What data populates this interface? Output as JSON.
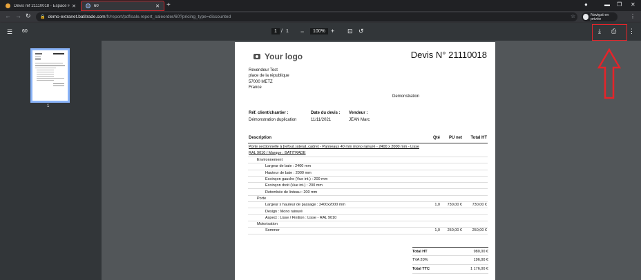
{
  "tabs": [
    {
      "title": "Devis réf 21110018 - Espace Pro"
    },
    {
      "title": "60"
    }
  ],
  "address_bar": {
    "url_host": "demo-extranet.batitrade.com",
    "url_path": "/fr/report/pdf/sale.report_saleorder/60?pricing_type=discounted"
  },
  "browser": {
    "incognito_label": "Navigat en privée"
  },
  "pdf_toolbar": {
    "doc_title": "60",
    "page_current": "1",
    "page_total": "1",
    "zoom": "100%"
  },
  "sidebar": {
    "thumb_label": "1"
  },
  "document": {
    "logo_text": "Your logo",
    "title": "Devis N° 21110018",
    "address": [
      "Revendeur Test",
      "place de la république",
      "57000 METZ",
      "France"
    ],
    "customer": "Demonstration",
    "meta": {
      "ref_label": "Réf. client/chantier :",
      "ref_value": "Démonstration duplication",
      "date_label": "Date du devis :",
      "date_value": "11/11/2021",
      "vendor_label": "Vendeur :",
      "vendor_value": "JEAN Marc"
    },
    "table_headers": {
      "description": "Description",
      "qty": "Qté",
      "unit": "PU net",
      "total": "Total HT"
    },
    "lines": [
      {
        "desc": "Porte sectionnelle à [refoul_lateral_cadre] - Panneaux 40 mm mono rainuré - 2400 x 2000 mm - Lisse RAL 9010 / Marque : BATITRADE",
        "indent": 0,
        "qty": "",
        "unit": "",
        "total": "",
        "style": "product"
      },
      {
        "desc": "Environnement",
        "indent": 1,
        "qty": "",
        "unit": "",
        "total": ""
      },
      {
        "desc": "Largeur de baie : 2400 mm",
        "indent": 2,
        "qty": "",
        "unit": "",
        "total": ""
      },
      {
        "desc": "Hauteur de baie : 2000 mm",
        "indent": 2,
        "qty": "",
        "unit": "",
        "total": ""
      },
      {
        "desc": "Ecoinçon gauche (Vue int.) : 200 mm",
        "indent": 2,
        "qty": "",
        "unit": "",
        "total": ""
      },
      {
        "desc": "Ecoinçon droit (Vue int.) : 200 mm",
        "indent": 2,
        "qty": "",
        "unit": "",
        "total": ""
      },
      {
        "desc": "Retombée de linteau : 200 mm",
        "indent": 2,
        "qty": "",
        "unit": "",
        "total": ""
      },
      {
        "desc": "Porte",
        "indent": 1,
        "qty": "",
        "unit": "",
        "total": ""
      },
      {
        "desc": "Largeur x hauteur de passage : 2400x2000 mm",
        "indent": 2,
        "qty": "1,0",
        "unit": "730,00 €",
        "total": "730,00 €"
      },
      {
        "desc": "Design : Mono rainuré",
        "indent": 2,
        "qty": "",
        "unit": "",
        "total": ""
      },
      {
        "desc": "Aspect : Lisse / Finition : Lisse - RAL 9010",
        "indent": 2,
        "qty": "",
        "unit": "",
        "total": ""
      },
      {
        "desc": "Motorisation",
        "indent": 1,
        "qty": "",
        "unit": "",
        "total": ""
      },
      {
        "desc": "Sommer",
        "indent": 2,
        "qty": "1,0",
        "unit": "250,00 €",
        "total": "250,00 €"
      }
    ],
    "totals": [
      {
        "label": "Total HT",
        "value": "980,00 €",
        "bold": true
      },
      {
        "label": "TVA 20%",
        "value": "196,00 €",
        "bold": false
      },
      {
        "label": "Total TTC",
        "value": "1 176,00 €",
        "bold": true
      }
    ]
  },
  "colors": {
    "annotation_red": "#e5242a",
    "tab_highlight": "#d4242a"
  }
}
